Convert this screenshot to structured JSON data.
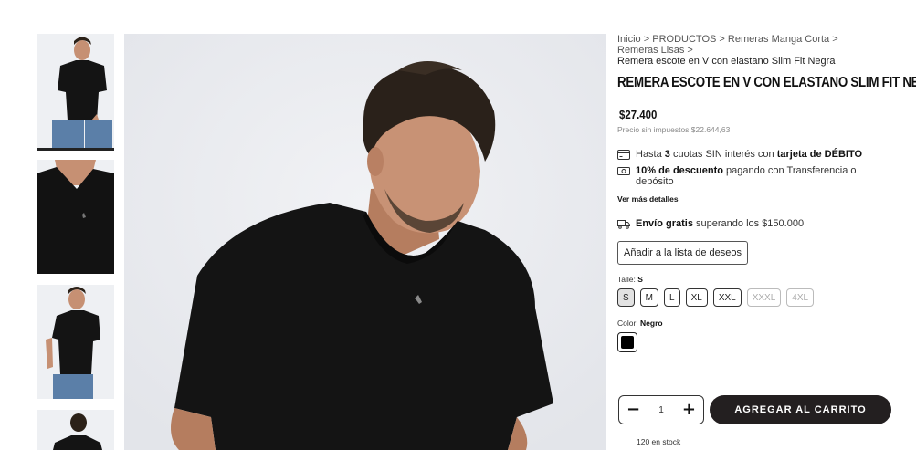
{
  "breadcrumb": {
    "items": [
      "Inicio",
      "PRODUCTOS",
      "Remeras Manga Corta",
      "Remeras Lisas"
    ],
    "separator": ">",
    "current": "Remera escote en V con elastano Slim Fit Negra"
  },
  "product": {
    "title": "Remera escote en V con elastano Slim Fit Negra",
    "price": "$27.400",
    "price_no_tax": "Precio sin impuestos $22.644,63"
  },
  "features": {
    "installments": {
      "pre": "Hasta ",
      "bold1": "3",
      "mid": " cuotas SIN interés con ",
      "bold2": "tarjeta de DÉBITO"
    },
    "discount": {
      "bold": "10% de descuento",
      "rest": " pagando con Transferencia o depósito"
    },
    "more_details": "Ver más detalles",
    "shipping": {
      "bold": "Envío gratis",
      "rest": " superando los $150.000"
    }
  },
  "wishlist_label": "Añadir a la lista de deseos",
  "size": {
    "label": "Talle: ",
    "selected": "S",
    "options": [
      {
        "label": "S",
        "state": "selected"
      },
      {
        "label": "M",
        "state": "available"
      },
      {
        "label": "L",
        "state": "available"
      },
      {
        "label": "XL",
        "state": "available"
      },
      {
        "label": "XXL",
        "state": "available"
      },
      {
        "label": "XXXL",
        "state": "unavailable"
      },
      {
        "label": "4XL",
        "state": "unavailable"
      }
    ]
  },
  "color": {
    "label": "Color: ",
    "selected": "Negro",
    "swatch_hex": "#000000"
  },
  "quantity": {
    "minus": "−",
    "value": "1",
    "plus": "+"
  },
  "add_to_cart_label": "AGREGAR AL CARRITO",
  "stock_text": "120 en stock",
  "icons": {
    "installments": "credit-card-icon",
    "discount": "cash-icon",
    "shipping": "truck-icon"
  },
  "colors": {
    "cart_button": "#231f20",
    "image_background": "#eceef2"
  }
}
